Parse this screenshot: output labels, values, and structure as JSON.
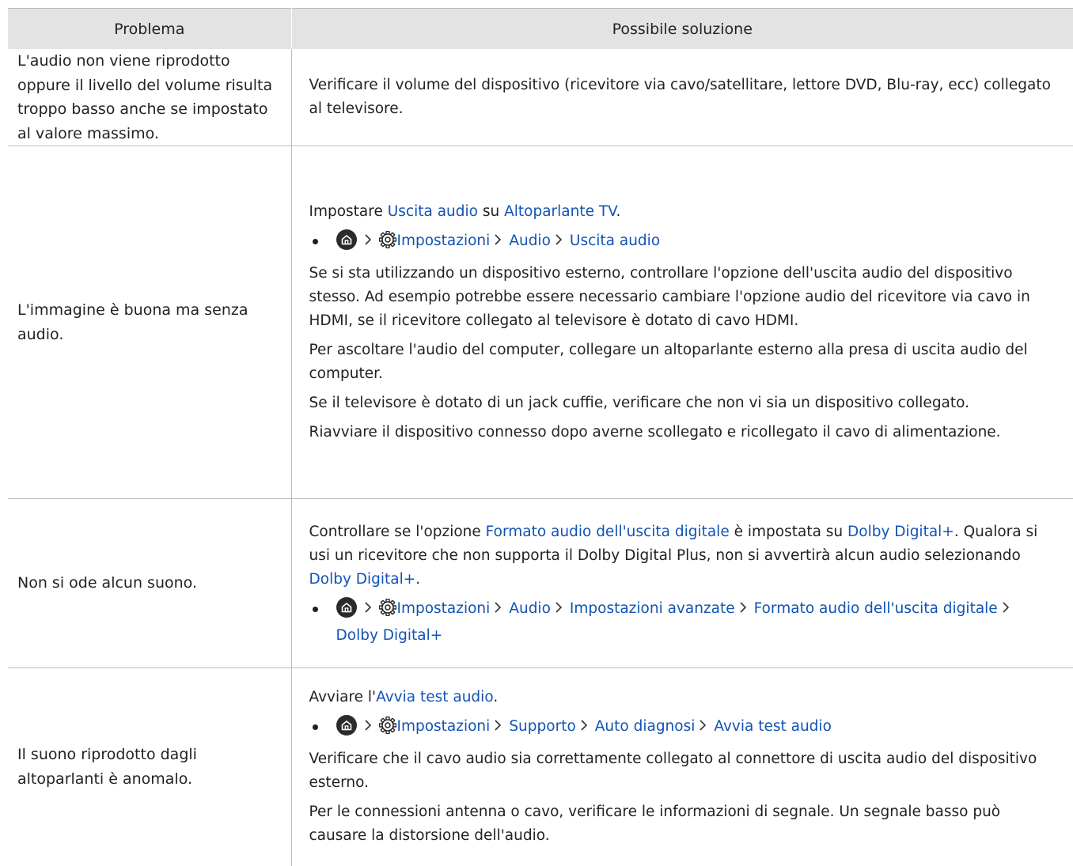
{
  "table": {
    "headers": [
      "Problema",
      "Possibile soluzione"
    ],
    "rows": [
      {
        "problem": "L'audio non viene riprodotto oppure il livello del volume risulta troppo basso anche se impostato al valore massimo.",
        "solution": [
          {
            "type": "text",
            "parts": [
              {
                "t": "Verificare il volume del dispositivo (ricevitore via cavo/satellitare, lettore DVD, Blu-ray, ecc) collegato al televisore."
              }
            ]
          }
        ]
      },
      {
        "problem": "L'immagine è buona ma senza audio.",
        "solution": [
          {
            "type": "text",
            "parts": [
              {
                "t": "Impostare "
              },
              {
                "t": "Uscita audio",
                "link": true
              },
              {
                "t": " su "
              },
              {
                "t": "Altoparlante TV",
                "link": true
              },
              {
                "t": "."
              }
            ]
          },
          {
            "type": "path",
            "items": [
              "Impostazioni",
              "Audio",
              "Uscita audio"
            ]
          },
          {
            "type": "text",
            "parts": [
              {
                "t": "Se si sta utilizzando un dispositivo esterno, controllare l'opzione dell'uscita audio del dispositivo stesso. Ad esempio potrebbe essere necessario cambiare l'opzione audio del ricevitore via cavo in HDMI, se il ricevitore collegato al televisore è dotato di cavo HDMI."
              }
            ]
          },
          {
            "type": "text",
            "parts": [
              {
                "t": "Per ascoltare l'audio del computer, collegare un altoparlante esterno alla presa di uscita audio del computer."
              }
            ]
          },
          {
            "type": "text",
            "parts": [
              {
                "t": "Se il televisore è dotato di un jack cuffie, verificare che non vi sia un dispositivo collegato."
              }
            ]
          },
          {
            "type": "text",
            "parts": [
              {
                "t": "Riavviare il dispositivo connesso dopo averne scollegato e ricollegato il cavo di alimentazione."
              }
            ]
          }
        ]
      },
      {
        "problem": "Non si ode alcun suono.",
        "solution": [
          {
            "type": "text",
            "parts": [
              {
                "t": "Controllare se l'opzione "
              },
              {
                "t": "Formato audio dell'uscita digitale",
                "link": true
              },
              {
                "t": " è impostata su "
              },
              {
                "t": "Dolby Digital+",
                "link": true
              },
              {
                "t": ". Qualora si usi un ricevitore che non supporta il Dolby Digital Plus, non si avvertirà alcun audio selezionando "
              },
              {
                "t": "Dolby Digital+",
                "link": true
              },
              {
                "t": "."
              }
            ]
          },
          {
            "type": "path",
            "items": [
              "Impostazioni",
              "Audio",
              "Impostazioni avanzate",
              "Formato audio dell'uscita digitale",
              "Dolby Digital+"
            ]
          }
        ]
      },
      {
        "problem": "Il suono riprodotto dagli altoparlanti è anomalo.",
        "solution": [
          {
            "type": "text",
            "parts": [
              {
                "t": "Avviare l'"
              },
              {
                "t": "Avvia test audio",
                "link": true
              },
              {
                "t": "."
              }
            ]
          },
          {
            "type": "path",
            "items": [
              "Impostazioni",
              "Supporto",
              "Auto diagnosi",
              "Avvia test audio"
            ]
          },
          {
            "type": "text",
            "parts": [
              {
                "t": "Verificare che il cavo audio sia correttamente collegato al connettore di uscita audio del dispositivo esterno."
              }
            ]
          },
          {
            "type": "text",
            "parts": [
              {
                "t": "Per le connessioni antenna o cavo, verificare le informazioni di segnale. Un segnale basso può causare la distorsione dell'audio."
              }
            ]
          }
        ]
      }
    ]
  },
  "colors": {
    "link": "#1253b4",
    "header_bg": "#e3e3e3",
    "rule": "#bdbdbd"
  },
  "icons": [
    "home-icon",
    "gear-icon",
    "chevron-right-icon"
  ]
}
